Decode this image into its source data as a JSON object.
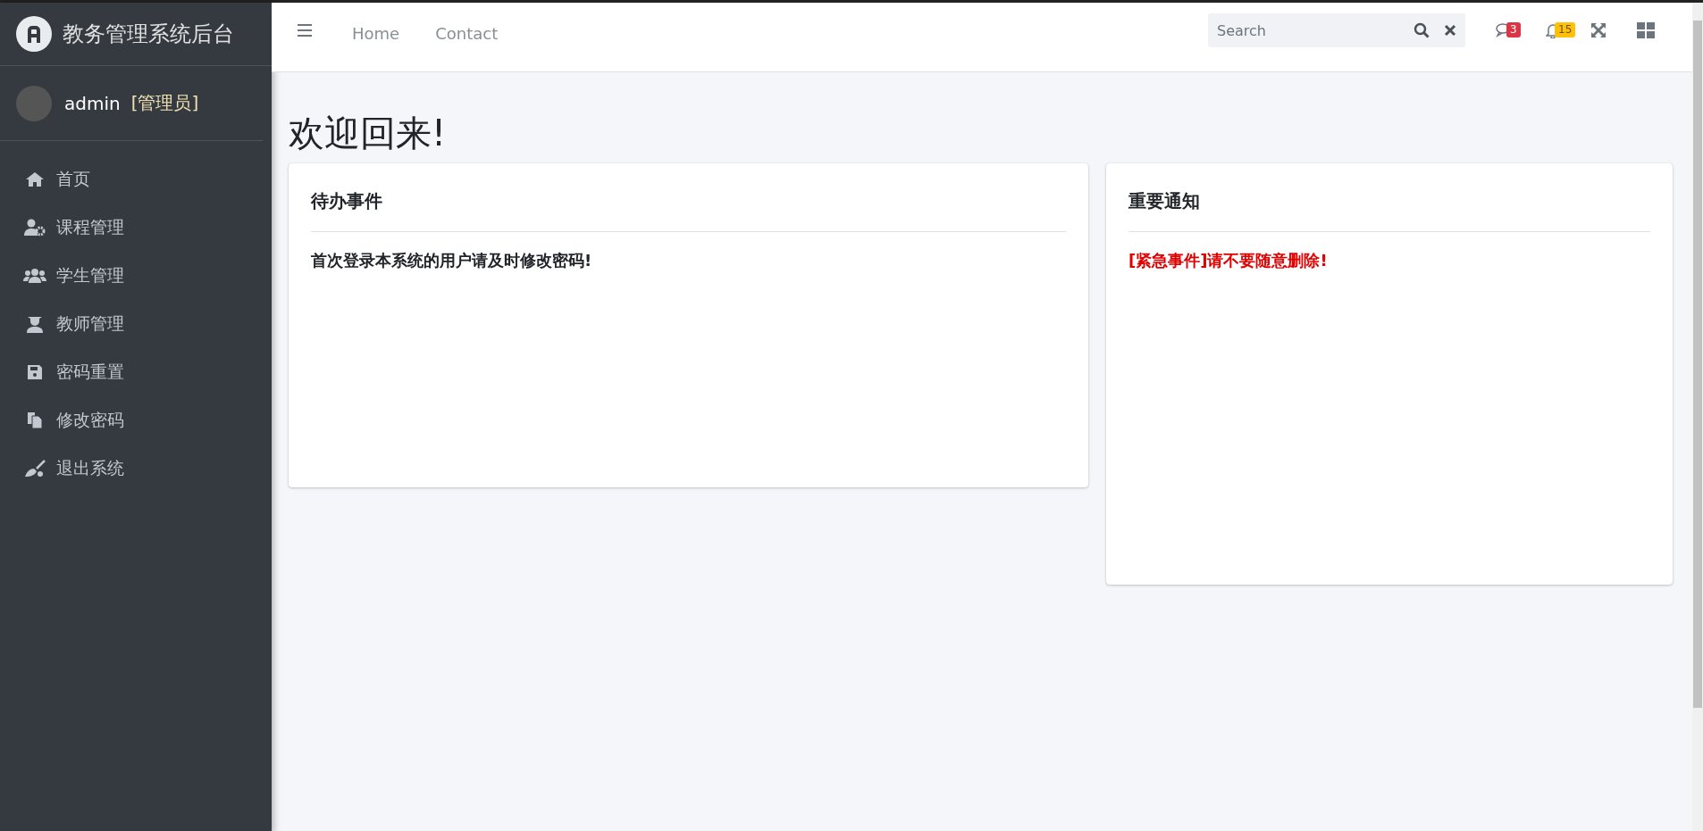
{
  "brand": {
    "title": "教务管理系统后台"
  },
  "user": {
    "name": "admin",
    "role": "[管理员]"
  },
  "sidebar": {
    "items": [
      {
        "label": "首页"
      },
      {
        "label": "课程管理"
      },
      {
        "label": "学生管理"
      },
      {
        "label": "教师管理"
      },
      {
        "label": "密码重置"
      },
      {
        "label": "修改密码"
      },
      {
        "label": "退出系统"
      }
    ]
  },
  "navbar": {
    "links": [
      "Home",
      "Contact"
    ],
    "search": {
      "placeholder": "Search"
    },
    "messages_badge": "3",
    "notifications_badge": "15"
  },
  "heading": "欢迎回来!",
  "cards": [
    {
      "title": "待办事件",
      "text": "首次登录本系统的用户请及时修改密码!",
      "kind": "normal"
    },
    {
      "title": "重要通知",
      "text": "[紧急事件]请不要随意删除!",
      "kind": "alert"
    }
  ]
}
